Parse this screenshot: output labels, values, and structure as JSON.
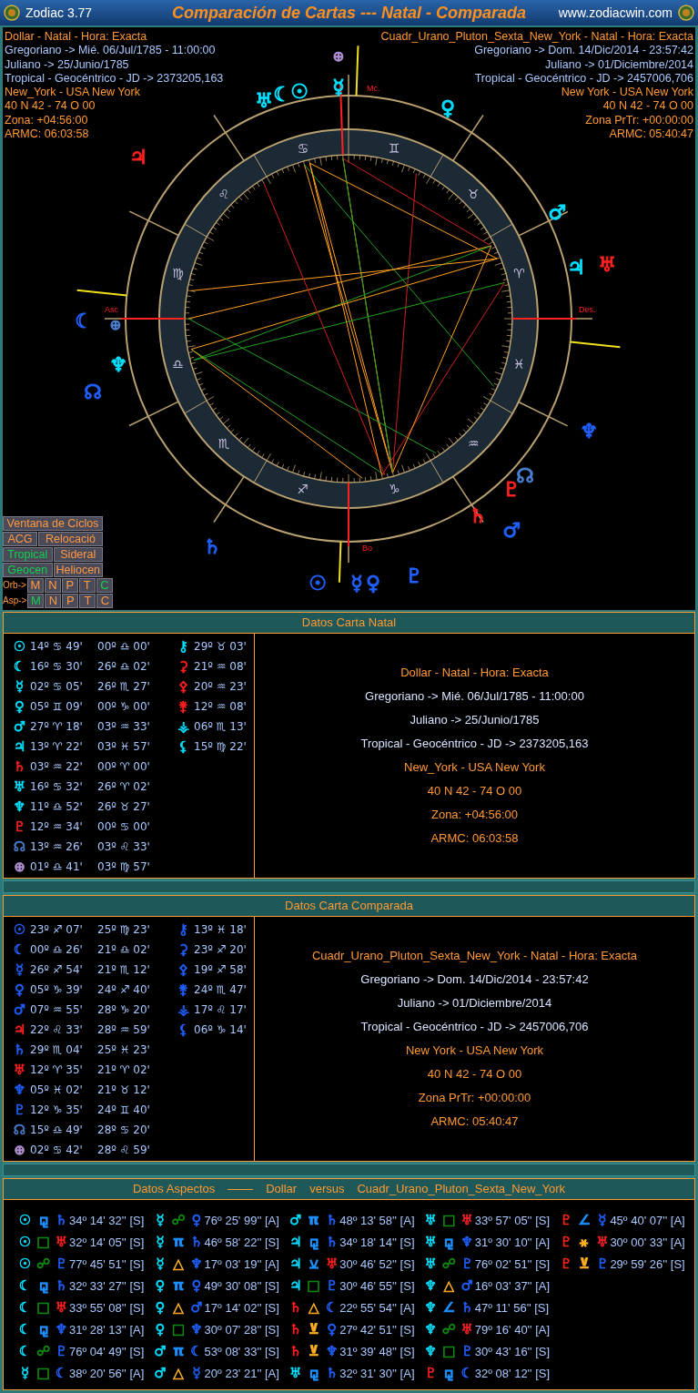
{
  "window": {
    "app": "Zodiac 3.77",
    "title": "Comparación de Cartas --- Natal - Comparada",
    "website": "www.zodiacwin.com"
  },
  "chart": {
    "natal_info": [
      {
        "text": "Dollar - Natal - Hora: Exacta",
        "color": "#ff9933"
      },
      {
        "text": "Gregoriano -> Mié. 06/Jul/1785 - 11:00:00",
        "color": "#a8c8ff"
      },
      {
        "text": "Juliano -> 25/Junio/1785",
        "color": "#a8c8ff"
      },
      {
        "text": "Tropical - Geocéntrico - JD -> 2373205,163",
        "color": "#a8c8ff"
      },
      {
        "text": "New_York - USA New York",
        "color": "#ff9933"
      },
      {
        "text": "40 N 42 - 74 O 00",
        "color": "#ff9933"
      },
      {
        "text": "Zona: +04:56:00",
        "color": "#ff9933"
      },
      {
        "text": "ARMC: 06:03:58",
        "color": "#ff9933"
      }
    ],
    "compared_info": [
      {
        "text": "Cuadr_Urano_Pluton_Sexta_New_York - Natal - Hora: Exacta",
        "color": "#ff9933"
      },
      {
        "text": "Gregoriano -> Dom. 14/Dic/2014 - 23:57:42",
        "color": "#a8c8ff"
      },
      {
        "text": "Juliano -> 01/Diciembre/2014",
        "color": "#a8c8ff"
      },
      {
        "text": "Tropical - Geocéntrico - JD -> 2457006,706",
        "color": "#a8c8ff"
      },
      {
        "text": "New York - USA New York",
        "color": "#ff9933"
      },
      {
        "text": "40 N 42 - 74 O 00",
        "color": "#ff9933"
      },
      {
        "text": "Zona PrTr: +00:00:00",
        "color": "#ff9933"
      },
      {
        "text": "ARMC: 05:40:47",
        "color": "#ff9933"
      }
    ],
    "angle_labels": [
      "Mc.",
      "Asc",
      "Des.",
      "Bo"
    ],
    "signs": [
      "♈",
      "♉",
      "♊",
      "♋",
      "♌",
      "♍",
      "♎",
      "♏",
      "♐",
      "♑",
      "♒",
      "♓"
    ],
    "glyphs": [
      {
        "glyph": "⊕",
        "color": "#b090d0"
      },
      {
        "glyph": "♅",
        "color": "#00e0ff"
      },
      {
        "glyph": "☾",
        "color": "#00e0ff"
      },
      {
        "glyph": "☉",
        "color": "#00e0ff"
      },
      {
        "glyph": "☿",
        "color": "#00e0ff"
      },
      {
        "glyph": "♀",
        "color": "#00e0ff"
      },
      {
        "glyph": "♂",
        "color": "#00e0ff"
      },
      {
        "glyph": "♃",
        "color": "#00e0ff"
      },
      {
        "glyph": "♅",
        "color": "#ff2020"
      },
      {
        "glyph": "☾",
        "color": "#2060ff"
      },
      {
        "glyph": "⊕",
        "color": "#4a7fd0"
      },
      {
        "glyph": "♆",
        "color": "#00e0ff"
      },
      {
        "glyph": "☊",
        "color": "#2060ff"
      },
      {
        "glyph": "♆",
        "color": "#2060ff"
      },
      {
        "glyph": "☊",
        "color": "#4a7fd0"
      },
      {
        "glyph": "♇",
        "color": "#ff2020"
      },
      {
        "glyph": "♄",
        "color": "#ff2020"
      },
      {
        "glyph": "♂",
        "color": "#2060ff"
      },
      {
        "glyph": "♄",
        "color": "#2060ff"
      },
      {
        "glyph": "☉",
        "color": "#2060ff"
      },
      {
        "glyph": "☿",
        "color": "#2060ff"
      },
      {
        "glyph": "♀",
        "color": "#2060ff"
      },
      {
        "glyph": "♇",
        "color": "#2060ff"
      },
      {
        "glyph": "♃",
        "color": "#ff2020"
      }
    ],
    "buttons": [
      {
        "label": "Ventana de Ciclos"
      },
      {
        "label": "ACG"
      },
      {
        "label": "Relocació"
      }
    ],
    "zodiac_modes": [
      {
        "label": "Tropical",
        "selected": true
      },
      {
        "label": "Sideral",
        "selected": false
      }
    ],
    "centers": [
      {
        "label": "Geocen",
        "selected": true
      },
      {
        "label": "Heliocen",
        "selected": false
      }
    ],
    "orb": {
      "label": "Orb->",
      "options": [
        {
          "label": "M",
          "selected": false
        },
        {
          "label": "N",
          "selected": false
        },
        {
          "label": "P",
          "selected": false
        },
        {
          "label": "T",
          "selected": false
        },
        {
          "label": "C",
          "selected": true
        }
      ]
    },
    "asp": {
      "label": "Asp->",
      "options": [
        {
          "label": "M",
          "selected": true
        },
        {
          "label": "N",
          "selected": false
        },
        {
          "label": "P",
          "selected": false
        },
        {
          "label": "T",
          "selected": false
        },
        {
          "label": "C",
          "selected": false
        }
      ]
    }
  },
  "natal_panel": {
    "title": "Datos Carta Natal",
    "planets": [
      {
        "glyph": "☉",
        "color": "#00e0ff",
        "position": "14º ♋ 49'",
        "cusp": "00º ♎ 00'"
      },
      {
        "glyph": "☾",
        "color": "#00e0ff",
        "position": "16º ♋ 30'",
        "cusp": "26º ♎ 02'"
      },
      {
        "glyph": "☿",
        "color": "#00e0ff",
        "position": "02º ♋ 05'",
        "cusp": "26º ♏ 27'"
      },
      {
        "glyph": "♀",
        "color": "#00e0ff",
        "position": "05º ♊ 09'",
        "cusp": "00º ♑ 00'"
      },
      {
        "glyph": "♂",
        "color": "#00e0ff",
        "position": "27º ♈ 18'",
        "cusp": "03º ♒ 33'"
      },
      {
        "glyph": "♃",
        "color": "#00e0ff",
        "position": "13º ♈ 22'",
        "cusp": "03º ♓ 57'"
      },
      {
        "glyph": "♄",
        "color": "#ff2020",
        "position": "03º ♒ 22'",
        "cusp": "00º ♈ 00'"
      },
      {
        "glyph": "♅",
        "color": "#00e0ff",
        "position": "16º ♋ 32'",
        "cusp": "26º ♈ 02'"
      },
      {
        "glyph": "♆",
        "color": "#00e0ff",
        "position": "11º ♎ 52'",
        "cusp": "26º ♉ 27'"
      },
      {
        "glyph": "♇",
        "color": "#ff2020",
        "position": "12º ♒ 34'",
        "cusp": "00º ♋ 00'"
      },
      {
        "glyph": "☊",
        "color": "#4a7fd0",
        "position": "13º ♒ 26'",
        "cusp": "03º ♌ 33'"
      },
      {
        "glyph": "⊕",
        "color": "#b090d0",
        "position": "01º ♎ 41'",
        "cusp": "03º ♍ 57'"
      }
    ],
    "asteroids": [
      {
        "glyph": "⚷",
        "color": "#00e0ff",
        "position": "29º ♉ 03'"
      },
      {
        "glyph": "⚳",
        "color": "#ff2020",
        "position": "21º ♒ 08'"
      },
      {
        "glyph": "⚴",
        "color": "#ff2020",
        "position": "20º ♒ 23'"
      },
      {
        "glyph": "⚵",
        "color": "#ff2020",
        "position": "12º ♒ 08'"
      },
      {
        "glyph": "⚶",
        "color": "#00e0ff",
        "position": "06º ♏ 13'"
      },
      {
        "glyph": "⚸",
        "color": "#00e0ff",
        "position": "15º ♍ 22'"
      }
    ],
    "info": [
      {
        "text": "Dollar - Natal - Hora: Exacta",
        "color": "#ff9933"
      },
      {
        "text": "Gregoriano -> Mié. 06/Jul/1785 - 11:00:00",
        "color": "#d8e4ff"
      },
      {
        "text": "Juliano -> 25/Junio/1785",
        "color": "#d8e4ff"
      },
      {
        "text": "Tropical - Geocéntrico - JD -> 2373205,163",
        "color": "#d8e4ff"
      },
      {
        "text": "New_York - USA New York",
        "color": "#ff9933"
      },
      {
        "text": "40 N 42 - 74 O 00",
        "color": "#ff9933"
      },
      {
        "text": "Zona: +04:56:00",
        "color": "#ff9933"
      },
      {
        "text": "ARMC: 06:03:58",
        "color": "#ff9933"
      }
    ]
  },
  "compared_panel": {
    "title": "Datos Carta Comparada",
    "planets": [
      {
        "glyph": "☉",
        "color": "#2060ff",
        "position": "23º ♐ 07'",
        "cusp": "25º ♍ 23'"
      },
      {
        "glyph": "☾",
        "color": "#2060ff",
        "position": "00º ♎ 26'",
        "cusp": "21º ♎ 02'"
      },
      {
        "glyph": "☿",
        "color": "#2060ff",
        "position": "26º ♐ 54'",
        "cusp": "21º ♏ 12'"
      },
      {
        "glyph": "♀",
        "color": "#2060ff",
        "position": "05º ♑ 39'",
        "cusp": "24º ♐ 40'"
      },
      {
        "glyph": "♂",
        "color": "#2060ff",
        "position": "07º ♒ 55'",
        "cusp": "28º ♑ 20'"
      },
      {
        "glyph": "♃",
        "color": "#ff2020",
        "position": "22º ♌ 33'",
        "cusp": "28º ♒ 59'"
      },
      {
        "glyph": "♄",
        "color": "#2060ff",
        "position": "29º ♏ 04'",
        "cusp": "25º ♓ 23'"
      },
      {
        "glyph": "♅",
        "color": "#ff2020",
        "position": "12º ♈ 35'",
        "cusp": "21º ♈ 02'"
      },
      {
        "glyph": "♆",
        "color": "#2060ff",
        "position": "05º ♓ 02'",
        "cusp": "21º ♉ 12'"
      },
      {
        "glyph": "♇",
        "color": "#2060ff",
        "position": "12º ♑ 35'",
        "cusp": "24º ♊ 40'"
      },
      {
        "glyph": "☊",
        "color": "#4a7fd0",
        "position": "15º ♎ 49'",
        "cusp": "28º ♋ 20'"
      },
      {
        "glyph": "⊕",
        "color": "#b090d0",
        "position": "02º ♋ 42'",
        "cusp": "28º ♌ 59'"
      }
    ],
    "asteroids": [
      {
        "glyph": "⚷",
        "color": "#2060ff",
        "position": "13º ♓ 18'"
      },
      {
        "glyph": "⚳",
        "color": "#2060ff",
        "position": "23º ♐ 20'"
      },
      {
        "glyph": "⚴",
        "color": "#2060ff",
        "position": "19º ♐ 58'"
      },
      {
        "glyph": "⚵",
        "color": "#2060ff",
        "position": "24º ♏ 47'"
      },
      {
        "glyph": "⚶",
        "color": "#2060ff",
        "position": "17º ♌ 17'"
      },
      {
        "glyph": "⚸",
        "color": "#2060ff",
        "position": "06º ♑ 14'"
      }
    ],
    "info": [
      {
        "text": "Cuadr_Urano_Pluton_Sexta_New_York - Natal - Hora: Exacta",
        "color": "#ff9933"
      },
      {
        "text": "Gregoriano -> Dom. 14/Dic/2014 - 23:57:42",
        "color": "#d8e4ff"
      },
      {
        "text": "Juliano -> 01/Diciembre/2014",
        "color": "#d8e4ff"
      },
      {
        "text": "Tropical - Geocéntrico - JD -> 2457006,706",
        "color": "#d8e4ff"
      },
      {
        "text": "New York - USA New York",
        "color": "#ff9933"
      },
      {
        "text": "40 N 42 - 74 O 00",
        "color": "#ff9933"
      },
      {
        "text": "Zona PrTr: +00:00:00",
        "color": "#ff9933"
      },
      {
        "text": "ARMC: 05:40:47",
        "color": "#ff9933"
      }
    ]
  },
  "aspects_panel": {
    "title": "Datos Aspectos",
    "left": "Dollar",
    "versus": "versus",
    "right": "Cuadr_Urano_Pluton_Sexta_New_York",
    "columns": [
      [
        {
          "p1": {
            "glyph": "☉",
            "color": "#00e0ff"
          },
          "aspect": {
            "glyph": "⚼",
            "color": "#1e90ff"
          },
          "p2": {
            "glyph": "♄",
            "color": "#2060ff"
          },
          "value": "34º 14' 32'' [S]"
        },
        {
          "p1": {
            "glyph": "☉",
            "color": "#00e0ff"
          },
          "aspect": {
            "glyph": "□",
            "color": "#109010"
          },
          "p2": {
            "glyph": "♅",
            "color": "#ff2020"
          },
          "value": "32º 14' 05'' [S]"
        },
        {
          "p1": {
            "glyph": "☉",
            "color": "#00e0ff"
          },
          "aspect": {
            "glyph": "☍",
            "color": "#109010"
          },
          "p2": {
            "glyph": "♇",
            "color": "#2060ff"
          },
          "value": "77º 45' 51'' [S]"
        },
        {
          "p1": {
            "glyph": "☾",
            "color": "#00e0ff"
          },
          "aspect": {
            "glyph": "⚼",
            "color": "#1e90ff"
          },
          "p2": {
            "glyph": "♄",
            "color": "#2060ff"
          },
          "value": "32º 33' 27'' [S]"
        },
        {
          "p1": {
            "glyph": "☾",
            "color": "#00e0ff"
          },
          "aspect": {
            "glyph": "□",
            "color": "#109010"
          },
          "p2": {
            "glyph": "♅",
            "color": "#ff2020"
          },
          "value": "33º 55' 08'' [S]"
        },
        {
          "p1": {
            "glyph": "☾",
            "color": "#00e0ff"
          },
          "aspect": {
            "glyph": "⚼",
            "color": "#1e90ff"
          },
          "p2": {
            "glyph": "♆",
            "color": "#2060ff"
          },
          "value": "31º 28' 13'' [A]"
        },
        {
          "p1": {
            "glyph": "☾",
            "color": "#00e0ff"
          },
          "aspect": {
            "glyph": "☍",
            "color": "#109010"
          },
          "p2": {
            "glyph": "♇",
            "color": "#2060ff"
          },
          "value": "76º 04' 49'' [S]"
        },
        {
          "p1": {
            "glyph": "☿",
            "color": "#00e0ff"
          },
          "aspect": {
            "glyph": "□",
            "color": "#109010"
          },
          "p2": {
            "glyph": "☾",
            "color": "#2060ff"
          },
          "value": "38º 20' 56'' [A]"
        }
      ],
      [
        {
          "p1": {
            "glyph": "☿",
            "color": "#00e0ff"
          },
          "aspect": {
            "glyph": "☍",
            "color": "#109010"
          },
          "p2": {
            "glyph": "♀",
            "color": "#2060ff"
          },
          "value": "76º 25' 99'' [A]"
        },
        {
          "p1": {
            "glyph": "☿",
            "color": "#00e0ff"
          },
          "aspect": {
            "glyph": "π",
            "color": "#1e90ff"
          },
          "p2": {
            "glyph": "♄",
            "color": "#2060ff"
          },
          "value": "46º 58' 22'' [S]"
        },
        {
          "p1": {
            "glyph": "☿",
            "color": "#00e0ff"
          },
          "aspect": {
            "glyph": "△",
            "color": "#ffb020"
          },
          "p2": {
            "glyph": "♆",
            "color": "#2060ff"
          },
          "value": "17º 03' 19'' [A]"
        },
        {
          "p1": {
            "glyph": "♀",
            "color": "#00e0ff"
          },
          "aspect": {
            "glyph": "π",
            "color": "#1e90ff"
          },
          "p2": {
            "glyph": "♀",
            "color": "#2060ff"
          },
          "value": "49º 30' 08'' [S]"
        },
        {
          "p1": {
            "glyph": "♀",
            "color": "#00e0ff"
          },
          "aspect": {
            "glyph": "△",
            "color": "#ffb020"
          },
          "p2": {
            "glyph": "♂",
            "color": "#2060ff"
          },
          "value": "17º 14' 02'' [S]"
        },
        {
          "p1": {
            "glyph": "♀",
            "color": "#00e0ff"
          },
          "aspect": {
            "glyph": "□",
            "color": "#109010"
          },
          "p2": {
            "glyph": "♆",
            "color": "#2060ff"
          },
          "value": "30º 07' 28'' [S]"
        },
        {
          "p1": {
            "glyph": "♂",
            "color": "#00e0ff"
          },
          "aspect": {
            "glyph": "π",
            "color": "#1e90ff"
          },
          "p2": {
            "glyph": "☾",
            "color": "#2060ff"
          },
          "value": "53º 08' 33'' [S]"
        },
        {
          "p1": {
            "glyph": "♂",
            "color": "#00e0ff"
          },
          "aspect": {
            "glyph": "△",
            "color": "#ffb020"
          },
          "p2": {
            "glyph": "☿",
            "color": "#2060ff"
          },
          "value": "20º 23' 21'' [A]"
        }
      ],
      [
        {
          "p1": {
            "glyph": "♂",
            "color": "#00e0ff"
          },
          "aspect": {
            "glyph": "π",
            "color": "#1e90ff"
          },
          "p2": {
            "glyph": "♄",
            "color": "#2060ff"
          },
          "value": "48º 13' 58'' [A]"
        },
        {
          "p1": {
            "glyph": "♃",
            "color": "#00e0ff"
          },
          "aspect": {
            "glyph": "⚼",
            "color": "#1e90ff"
          },
          "p2": {
            "glyph": "♄",
            "color": "#2060ff"
          },
          "value": "34º 18' 14'' [S]"
        },
        {
          "p1": {
            "glyph": "♃",
            "color": "#00e0ff"
          },
          "aspect": {
            "glyph": "⚺",
            "color": "#1e90ff"
          },
          "p2": {
            "glyph": "♅",
            "color": "#ff2020"
          },
          "value": "30º 46' 52'' [S]"
        },
        {
          "p1": {
            "glyph": "♃",
            "color": "#00e0ff"
          },
          "aspect": {
            "glyph": "□",
            "color": "#109010"
          },
          "p2": {
            "glyph": "♇",
            "color": "#2060ff"
          },
          "value": "30º 46' 55'' [S]"
        },
        {
          "p1": {
            "glyph": "♄",
            "color": "#ff2020"
          },
          "aspect": {
            "glyph": "△",
            "color": "#ffb020"
          },
          "p2": {
            "glyph": "☾",
            "color": "#2060ff"
          },
          "value": "22º 55' 54'' [A]"
        },
        {
          "p1": {
            "glyph": "♄",
            "color": "#ff2020"
          },
          "aspect": {
            "glyph": "⊻",
            "color": "#ffb020"
          },
          "p2": {
            "glyph": "♀",
            "color": "#2060ff"
          },
          "value": "27º 42' 51'' [S]"
        },
        {
          "p1": {
            "glyph": "♄",
            "color": "#ff2020"
          },
          "aspect": {
            "glyph": "⊻",
            "color": "#ffb020"
          },
          "p2": {
            "glyph": "♆",
            "color": "#2060ff"
          },
          "value": "31º 39' 48'' [S]"
        },
        {
          "p1": {
            "glyph": "♅",
            "color": "#00e0ff"
          },
          "aspect": {
            "glyph": "⚼",
            "color": "#1e90ff"
          },
          "p2": {
            "glyph": "♄",
            "color": "#2060ff"
          },
          "value": "32º 31' 30'' [A]"
        }
      ],
      [
        {
          "p1": {
            "glyph": "♅",
            "color": "#00e0ff"
          },
          "aspect": {
            "glyph": "□",
            "color": "#109010"
          },
          "p2": {
            "glyph": "♅",
            "color": "#ff2020"
          },
          "value": "33º 57' 05'' [S]"
        },
        {
          "p1": {
            "glyph": "♅",
            "color": "#00e0ff"
          },
          "aspect": {
            "glyph": "⚼",
            "color": "#1e90ff"
          },
          "p2": {
            "glyph": "♆",
            "color": "#2060ff"
          },
          "value": "31º 30' 10'' [A]"
        },
        {
          "p1": {
            "glyph": "♅",
            "color": "#00e0ff"
          },
          "aspect": {
            "glyph": "☍",
            "color": "#109010"
          },
          "p2": {
            "glyph": "♇",
            "color": "#2060ff"
          },
          "value": "76º 02' 51'' [S]"
        },
        {
          "p1": {
            "glyph": "♆",
            "color": "#00e0ff"
          },
          "aspect": {
            "glyph": "△",
            "color": "#ffb020"
          },
          "p2": {
            "glyph": "♂",
            "color": "#2060ff"
          },
          "value": "16º 03' 37'' [A]"
        },
        {
          "p1": {
            "glyph": "♆",
            "color": "#00e0ff"
          },
          "aspect": {
            "glyph": "∠",
            "color": "#1e90ff"
          },
          "p2": {
            "glyph": "♄",
            "color": "#2060ff"
          },
          "value": "47º 11' 56'' [S]"
        },
        {
          "p1": {
            "glyph": "♆",
            "color": "#00e0ff"
          },
          "aspect": {
            "glyph": "☍",
            "color": "#109010"
          },
          "p2": {
            "glyph": "♅",
            "color": "#ff2020"
          },
          "value": "79º 16' 40'' [A]"
        },
        {
          "p1": {
            "glyph": "♆",
            "color": "#00e0ff"
          },
          "aspect": {
            "glyph": "□",
            "color": "#109010"
          },
          "p2": {
            "glyph": "♇",
            "color": "#2060ff"
          },
          "value": "30º 43' 16'' [S]"
        },
        {
          "p1": {
            "glyph": "♇",
            "color": "#ff2020"
          },
          "aspect": {
            "glyph": "⚼",
            "color": "#1e90ff"
          },
          "p2": {
            "glyph": "☾",
            "color": "#2060ff"
          },
          "value": "32º 08' 12'' [S]"
        }
      ],
      [
        {
          "p1": {
            "glyph": "♇",
            "color": "#ff2020"
          },
          "aspect": {
            "glyph": "∠",
            "color": "#1e90ff"
          },
          "p2": {
            "glyph": "☿",
            "color": "#2060ff"
          },
          "value": "45º 40' 07'' [A]"
        },
        {
          "p1": {
            "glyph": "♇",
            "color": "#ff2020"
          },
          "aspect": {
            "glyph": "⚹",
            "color": "#ffb020"
          },
          "p2": {
            "glyph": "♅",
            "color": "#ff2020"
          },
          "value": "30º 00' 33'' [A]"
        },
        {
          "p1": {
            "glyph": "♇",
            "color": "#ff2020"
          },
          "aspect": {
            "glyph": "⊻",
            "color": "#ffb020"
          },
          "p2": {
            "glyph": "♇",
            "color": "#2060ff"
          },
          "value": "29º 59' 26'' [S]"
        }
      ]
    ]
  }
}
